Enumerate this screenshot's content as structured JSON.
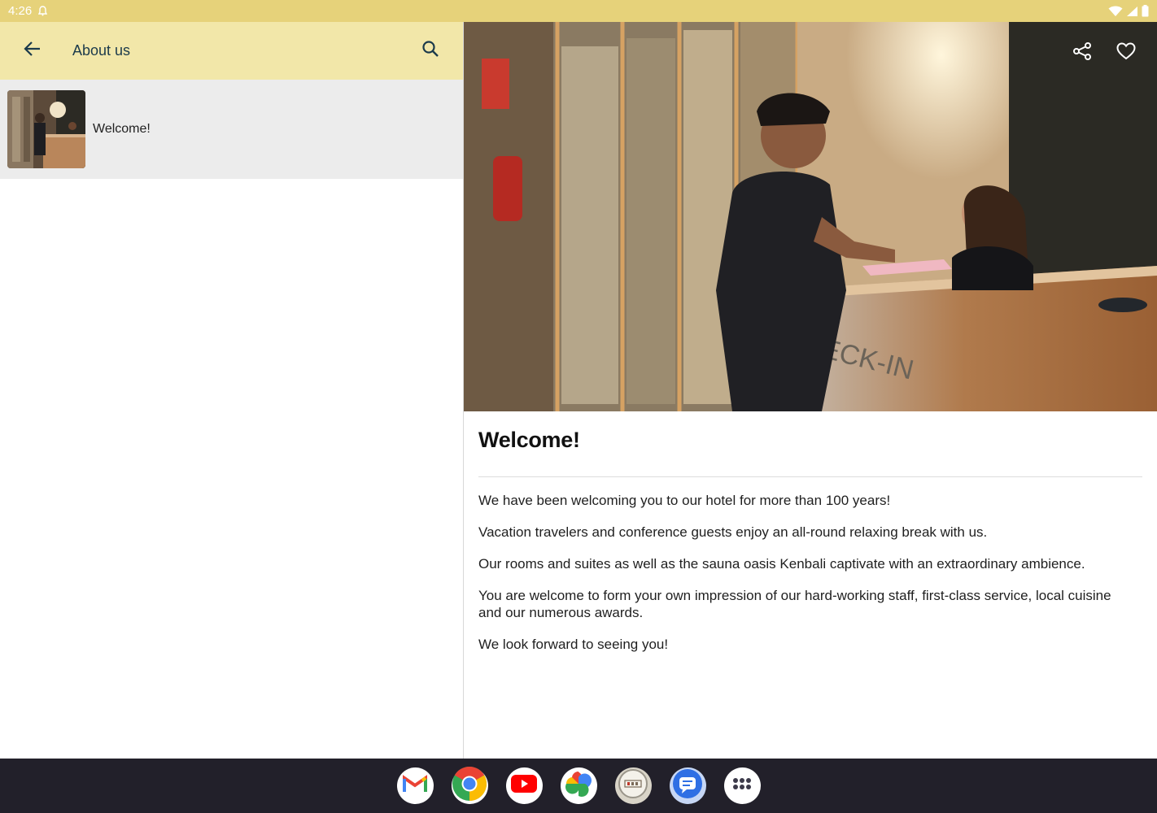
{
  "status_bar": {
    "time": "4:26",
    "icons": [
      "notification-icon",
      "wifi-icon",
      "signal-icon",
      "battery-icon"
    ]
  },
  "app_bar": {
    "title": "About us",
    "back_icon": "arrow-back-icon",
    "search_icon": "search-icon"
  },
  "list": {
    "items": [
      {
        "label": "Welcome!",
        "thumbnail": "hotel-reception-photo"
      }
    ]
  },
  "detail": {
    "share_icon": "share-icon",
    "favorite_icon": "heart-icon",
    "headline": "Welcome!",
    "paragraphs": [
      "We have been welcoming you to our hotel for more than 100 years!",
      "Vacation travelers and conference guests enjoy an all-round relaxing break with us.",
      "Our rooms and suites as well as the sauna oasis Kenbali captivate with an extraordinary ambience.",
      "You are welcome to form your own impression of our hard-working staff, first-class service, local cuisine and our numerous awards.",
      "We look forward to seeing you!"
    ],
    "hero_text": "CHECK-IN"
  },
  "taskbar": {
    "apps": [
      "gmail-icon",
      "chrome-icon",
      "youtube-icon",
      "photos-icon",
      "hotel-app-icon",
      "messages-icon",
      "app-drawer-icon"
    ]
  },
  "colors": {
    "status_bar": "#e6d27a",
    "app_bar": "#f2e7a9",
    "accent": "#1b3a4b",
    "taskbar": "#22202a"
  }
}
